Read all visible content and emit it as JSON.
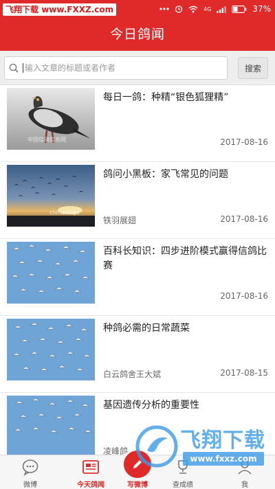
{
  "status_bar": {
    "watermark_name": "飞翔下载",
    "watermark_url": "www.FXXZ.com",
    "battery": "37%",
    "network": "4G"
  },
  "header": {
    "title": "今日鸽闻"
  },
  "search": {
    "placeholder": "输入文章的标题或者作者",
    "button_label": "搜索"
  },
  "articles": [
    {
      "title": "每日一鸽：种精“银色狐狸精”",
      "author": "",
      "date": "2017-08-16",
      "thumbnail": "pigeon-portrait",
      "thumb_caption": "中国信鸽信息网"
    },
    {
      "title": "鸽问小黑板：家飞常见的问题",
      "author": "铁羽展翅",
      "date": "2017-08-16",
      "thumbnail": "pigeons-sunset-sky",
      "thumb_caption": "chinaxinge"
    },
    {
      "title": "百科长知识：四步进阶模式赢得信鸽比赛",
      "author": "",
      "date": "2017-08-16",
      "thumbnail": "pigeon-flock-blue-sky"
    },
    {
      "title": "种鸽必需的日常蔬菜",
      "author": "白云鸽舍王大斌",
      "date": "2017-08-15",
      "thumbnail": "pigeon-flock-blue-sky"
    },
    {
      "title": "基因遗传分析的重要性",
      "author": "凌峰鸽",
      "date": "",
      "thumbnail": "pigeon-flock-blue-sky"
    }
  ],
  "bottom_nav": {
    "weibo": "微博",
    "today": "今天鸽闻",
    "center": "写微博",
    "scores": "查成绩",
    "me": "我"
  },
  "watermark": {
    "text": "飞翔下载",
    "url": "www.fxxz.com"
  },
  "colors": {
    "accent": "#e02a2a",
    "watermark_blue": "#3d9ae8"
  }
}
